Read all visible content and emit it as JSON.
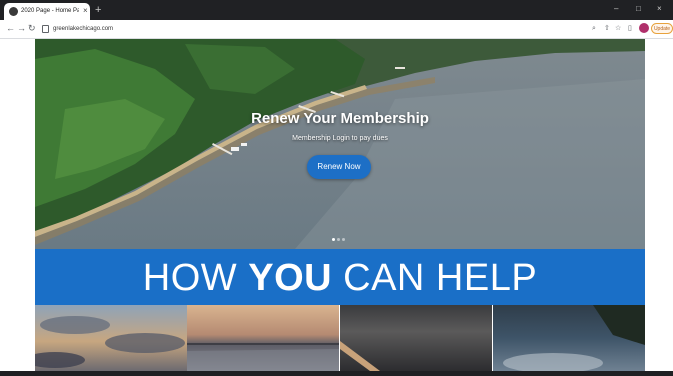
{
  "browser": {
    "tab_title": "2020 Page - Home Page - Green...",
    "tab_close": "×",
    "new_tab": "+",
    "window_controls": [
      "–",
      "□",
      "×"
    ],
    "nav": {
      "back": "←",
      "forward": "→",
      "reload": "↻"
    },
    "url": "greenlakechicago.com",
    "toolbar_icons": [
      "search-icon",
      "share-icon",
      "star-icon",
      "sidebar-icon"
    ],
    "toolbar_glyphs": [
      "⌕",
      "⇧",
      "☆",
      "▯"
    ],
    "update_label": "Update"
  },
  "hero": {
    "title": "Renew Your Membership",
    "subtitle": "Membership Login to pay dues",
    "button_label": "Renew Now",
    "slides": 3,
    "active_slide": 1
  },
  "help_band": {
    "pre": "HOW ",
    "bold": "YOU",
    "post": " CAN HELP"
  },
  "colors": {
    "accent_blue": "#1a6fc7",
    "button_blue": "#1d6fc6",
    "update_orange": "#e8a23c"
  }
}
